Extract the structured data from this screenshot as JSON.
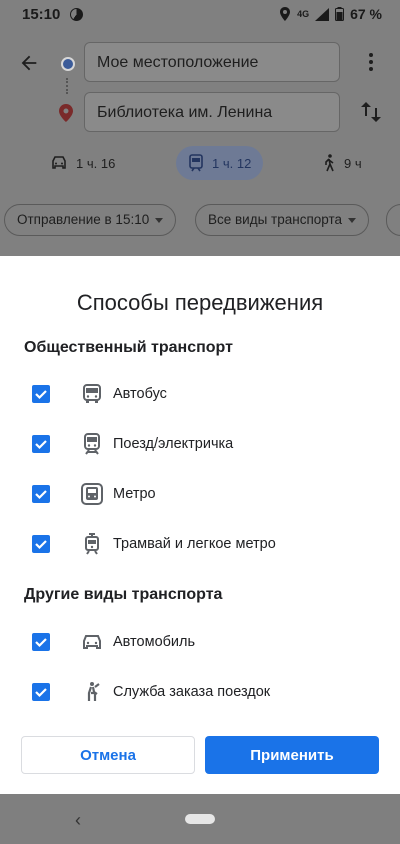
{
  "status_bar": {
    "time": "15:10",
    "network": "4G",
    "battery": "67 %"
  },
  "directions": {
    "origin": "Мое местоположение",
    "destination": "Библиотека им. Ленина",
    "modes": [
      {
        "name": "car",
        "duration": "1 ч. 16",
        "icon": "car-icon"
      },
      {
        "name": "transit",
        "duration": "1 ч. 12",
        "icon": "transit-icon",
        "selected": true
      },
      {
        "name": "walk",
        "duration": "9 ч",
        "icon": "walk-icon"
      }
    ],
    "filters": {
      "departure": "Отправление в 15:10",
      "types": "Все виды транспорта"
    }
  },
  "sheet": {
    "title": "Способы передвижения",
    "public_section": "Общественный транспорт",
    "public_items": [
      {
        "label": "Автобус",
        "checked": true,
        "icon": "bus-icon"
      },
      {
        "label": "Поезд/электричка",
        "checked": true,
        "icon": "train-icon"
      },
      {
        "label": "Метро",
        "checked": true,
        "icon": "subway-icon"
      },
      {
        "label": "Трамвай и легкое метро",
        "checked": true,
        "icon": "tram-icon"
      }
    ],
    "other_section": "Другие виды транспорта",
    "other_items": [
      {
        "label": "Автомобиль",
        "checked": true,
        "icon": "car-icon"
      },
      {
        "label": "Служба заказа поездок",
        "checked": true,
        "icon": "ride-hail-icon"
      }
    ],
    "cancel_label": "Отмена",
    "apply_label": "Применить"
  },
  "colors": {
    "accent": "#1a73e8",
    "scrim": "#808080"
  }
}
